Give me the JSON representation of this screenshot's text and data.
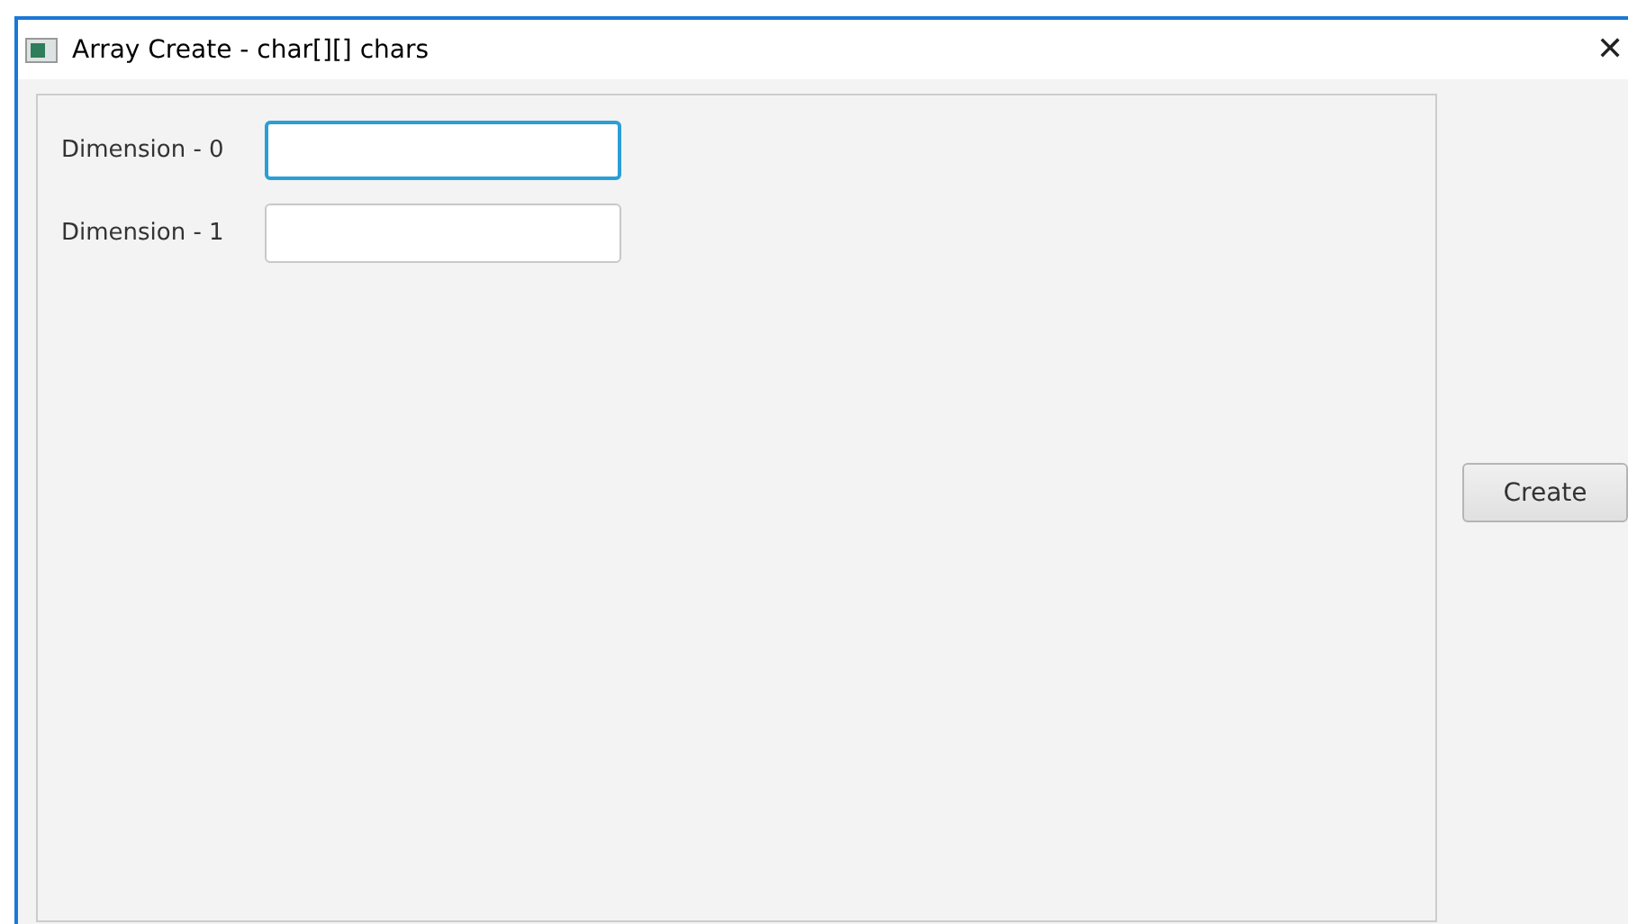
{
  "window": {
    "title": "Array Create - char[][] chars",
    "close": "✕"
  },
  "fields": [
    {
      "label": "Dimension - 0",
      "focused": true
    },
    {
      "label": "Dimension - 1",
      "focused": false
    }
  ],
  "buttons": [
    "Create"
  ]
}
